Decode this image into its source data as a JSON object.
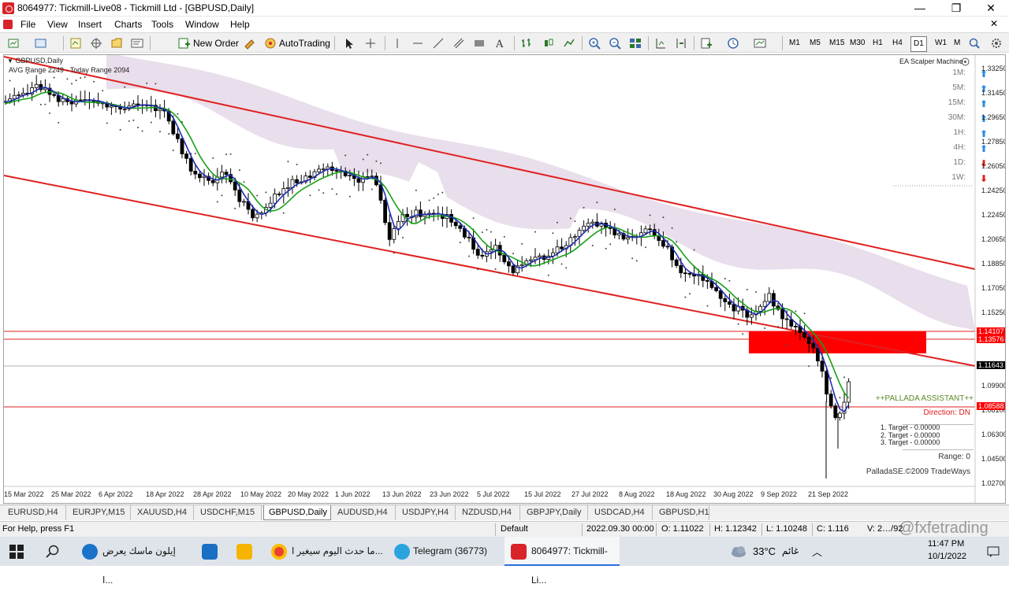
{
  "window": {
    "title": "8064977: Tickmill-Live08 - Tickmill Ltd - [GBPUSD,Daily]",
    "minimize": "—",
    "maximize": "❐",
    "close": "✕"
  },
  "menu": [
    "File",
    "View",
    "Insert",
    "Charts",
    "Tools",
    "Window",
    "Help"
  ],
  "toolbar": {
    "new_order": "New Order",
    "auto_trading": "AutoTrading",
    "timeframes": [
      "M1",
      "M5",
      "M15",
      "M30",
      "H1",
      "H4",
      "D1",
      "W1",
      "M"
    ],
    "active_timeframe": "D1"
  },
  "chart": {
    "symbol_label": "GBPUSD,Daily",
    "avg_range_label": "AVG Range 2249 - Today Range 2094",
    "ea_title": "EA Scalper Machine",
    "ea_signals": [
      {
        "tf": "1M:",
        "dir": "up"
      },
      {
        "tf": "5M:",
        "dir": "up"
      },
      {
        "tf": "15M:",
        "dir": "up"
      },
      {
        "tf": "30M:",
        "dir": "up"
      },
      {
        "tf": "1H:",
        "dir": "up"
      },
      {
        "tf": "4H:",
        "dir": "up"
      },
      {
        "tf": "1D:",
        "dir": "down"
      },
      {
        "tf": "1W:",
        "dir": "down"
      }
    ],
    "price_axis": [
      "1.33250",
      "1.31450",
      "1.29650",
      "1.27850",
      "1.26050",
      "1.24250",
      "1.22450",
      "1.20650",
      "1.18850",
      "1.17050",
      "1.15250",
      "1.09900",
      "1.08100",
      "1.06300",
      "1.04500",
      "1.02700"
    ],
    "price_tags": {
      "level1": "1.14107",
      "level2": "1.13576",
      "current": "1.11643",
      "level3": "1.08588"
    },
    "date_axis": [
      "15 Mar 2022",
      "25 Mar 2022",
      "6 Apr 2022",
      "18 Apr 2022",
      "28 Apr 2022",
      "10 May 2022",
      "20 May 2022",
      "1 Jun 2022",
      "13 Jun 2022",
      "23 Jun 2022",
      "5 Jul 2022",
      "15 Jul 2022",
      "27 Jul 2022",
      "8 Aug 2022",
      "18 Aug 2022",
      "30 Aug 2022",
      "9 Sep 2022",
      "21 Sep 2022"
    ],
    "assistant": {
      "title": "++PALLADA ASSISTANT++",
      "direction": "Direction: DN",
      "targets": [
        "1. Target - 0.00000",
        "2. Target - 0.00000",
        "3. Target - 0.00000"
      ],
      "range": "Range: 0",
      "copyright": "PalladaSE.©2009 TradeWays"
    },
    "colors": {
      "channel": "#e02020",
      "cloud": "#e3d6e6",
      "ma_fast": "#1f2fb0",
      "ma_slow": "#18a018",
      "zone": "#ff0000"
    }
  },
  "tabs": [
    "EURUSD,H4",
    "EURJPY,M15",
    "XAUUSD,H4",
    "USDCHF,M15",
    "GBPUSD,Daily",
    "AUDUSD,H4",
    "USDJPY,H4",
    "NZDUSD,H4",
    "GBPJPY,Daily",
    "USDCAD,H4",
    "GBPUSD,H1"
  ],
  "active_tab": "GBPUSD,Daily",
  "status": {
    "help": "For Help, press F1",
    "profile": "Default",
    "datetime": "2022.09.30 00:00",
    "open": "O: 1.11022",
    "high": "H: 1.12342",
    "low": "L: 1.10248",
    "close": "C: 1.116",
    "volume": "V: 2…/92"
  },
  "watermark": "@fxfetrading",
  "taskbar": {
    "apps": [
      {
        "label": "إيلون ماسك يعرض ا...",
        "color": "#1a73c8"
      },
      {
        "label": "",
        "color": "#1a6fc4"
      },
      {
        "label": "",
        "color": "#f4b400"
      },
      {
        "label": "ما حدث اليوم سيغير ا...",
        "color": "#e94235"
      },
      {
        "label": "Telegram (36773)",
        "color": "#2aa3df"
      },
      {
        "label": "8064977: Tickmill-Li...",
        "color": "#d8232a"
      }
    ],
    "weather_temp": "33°C",
    "weather_text": "غائم",
    "time": "11:47 PM",
    "date": "10/1/2022"
  }
}
